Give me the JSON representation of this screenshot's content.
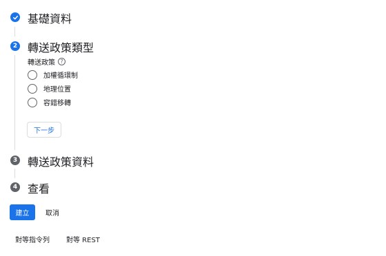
{
  "steps": [
    {
      "number": "",
      "title": "基礎資料",
      "state": "done"
    },
    {
      "number": "2",
      "title": "轉送政策類型",
      "state": "active"
    },
    {
      "number": "3",
      "title": "轉送政策資料",
      "state": "todo"
    },
    {
      "number": "4",
      "title": "查看",
      "state": "todo"
    }
  ],
  "policy": {
    "label": "轉送政策",
    "help_icon": "help-circle-icon",
    "options": [
      "加權循環制",
      "地理位置",
      "容錯移轉"
    ],
    "next_label": "下一步"
  },
  "actions": {
    "create_label": "建立",
    "cancel_label": "取消"
  },
  "equivalents": {
    "command_line_label": "對等指令列",
    "rest_label": "對等 REST"
  },
  "colors": {
    "accent": "#1a73e8",
    "todo_step": "#5f6368",
    "border": "#dadce0"
  }
}
